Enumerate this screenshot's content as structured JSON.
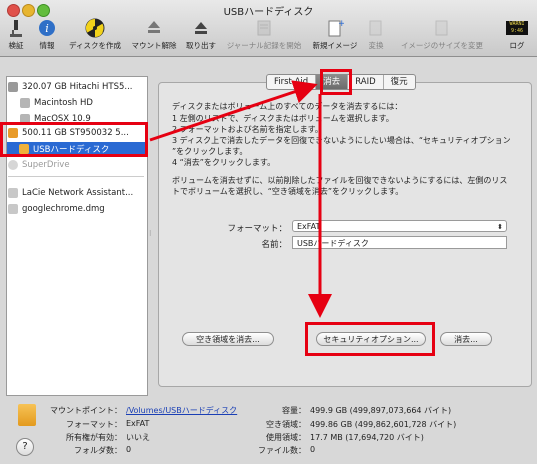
{
  "window": {
    "title": "USBハードディスク"
  },
  "toolbar": [
    {
      "label": "検証",
      "icon": "microscope-icon"
    },
    {
      "label": "情報",
      "icon": "info-icon"
    },
    {
      "label": "ディスクを作成",
      "icon": "burn-icon"
    },
    {
      "label": "マウント解除",
      "icon": "unmount-icon"
    },
    {
      "label": "取り出す",
      "icon": "eject-icon"
    },
    {
      "label": "ジャーナル記録を開始",
      "icon": "journal-icon"
    },
    {
      "label": "新規イメージ",
      "icon": "new-image-icon"
    },
    {
      "label": "変換",
      "icon": "convert-icon"
    },
    {
      "label": "イメージのサイズを変更",
      "icon": "resize-image-icon"
    },
    {
      "label": "ログ",
      "icon": "log-icon",
      "badge": "WARNI 9:46"
    }
  ],
  "sidebar": {
    "items": [
      {
        "label": "320.07 GB Hitachi HTS5..."
      },
      {
        "label": "Macintosh HD"
      },
      {
        "label": "MacOSX 10.9"
      },
      {
        "label": "500.11 GB ST950032 5..."
      },
      {
        "label": "USBハードディスク"
      },
      {
        "label": "SuperDrive"
      },
      {
        "label": "LaCie Network Assistant..."
      },
      {
        "label": "googlechrome.dmg"
      }
    ]
  },
  "tabs": [
    "First Aid",
    "消去",
    "RAID",
    "復元"
  ],
  "instructions": {
    "line1": "ディスクまたはボリューム上のすべてのデータを消去するには：",
    "line2": "1  左側のリストで、ディスクまたはボリュームを選択します。",
    "line3": "2  フォーマットおよび名前を指定します。",
    "line4": "3  ディスク上で消去したデータを回復できないようにしたい場合は、“セキュリティオプション",
    "line5": "    ”をクリックします。",
    "line6": "4  “消去”をクリックします。",
    "line7": "ボリュームを消去せずに、以前削除したファイルを回復できないようにするには、左側のリス",
    "line8": "トでボリュームを選択し、“空き領域を消去”をクリックします。"
  },
  "format": {
    "label": "フォーマット：",
    "value": "ExFAT"
  },
  "name": {
    "label": "名前：",
    "value": "USBハードディスク"
  },
  "buttons": {
    "erase_free": "空き領域を消去...",
    "security": "セキュリティオプション...",
    "erase": "消去..."
  },
  "info": {
    "mount_label": "マウントポイント：",
    "mount_value": "/Volumes/USBハードディスク",
    "format_label": "フォーマット：",
    "format_value": "ExFAT",
    "owners_label": "所有権が有効：",
    "owners_value": "いいえ",
    "folders_label": "フォルダ数：",
    "folders_value": "0",
    "capacity_label": "容量：",
    "capacity_value": "499.9 GB (499,897,073,664 バイト)",
    "available_label": "空き領域：",
    "available_value": "499.86 GB (499,862,601,728 バイト)",
    "used_label": "使用領域：",
    "used_value": "17.7 MB (17,694,720 バイト)",
    "files_label": "ファイル数：",
    "files_value": "0"
  },
  "colors": {
    "highlight": "#e60012",
    "selection": "#2a6ad3"
  }
}
